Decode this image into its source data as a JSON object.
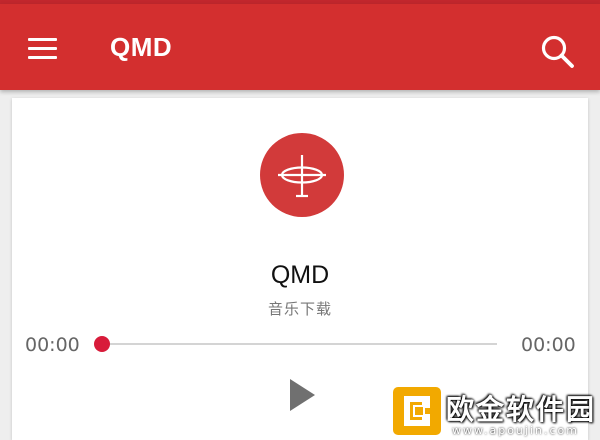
{
  "app": {
    "title": "QMD",
    "menu_icon": "hamburger-menu-icon",
    "search_icon": "search-icon",
    "bar_color": "#d32f2f"
  },
  "player": {
    "logo_icon": "qmd-logo-icon",
    "logo_color": "#d23a3a",
    "name": "QMD",
    "subtitle": "音乐下载",
    "time_elapsed": "00:00",
    "time_total": "00:00",
    "progress": 0,
    "accent_color": "#d81b3a",
    "play_icon": "play-icon"
  },
  "watermark": {
    "text": "欧金软件园",
    "url": "www.apoujin.com",
    "logo": "apoujin-logo"
  }
}
